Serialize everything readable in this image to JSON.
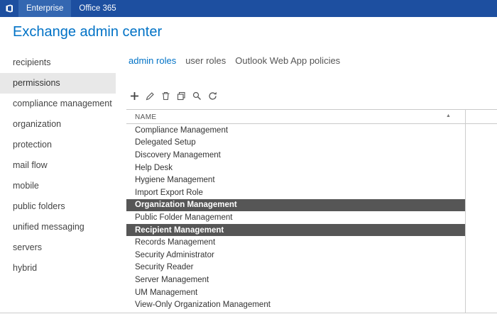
{
  "topbar": {
    "enterprise_label": "Enterprise",
    "office365_label": "Office 365"
  },
  "header": {
    "title": "Exchange admin center"
  },
  "sidebar": {
    "items": [
      {
        "label": "recipients",
        "selected": false
      },
      {
        "label": "permissions",
        "selected": true
      },
      {
        "label": "compliance management",
        "selected": false
      },
      {
        "label": "organization",
        "selected": false
      },
      {
        "label": "protection",
        "selected": false
      },
      {
        "label": "mail flow",
        "selected": false
      },
      {
        "label": "mobile",
        "selected": false
      },
      {
        "label": "public folders",
        "selected": false
      },
      {
        "label": "unified messaging",
        "selected": false
      },
      {
        "label": "servers",
        "selected": false
      },
      {
        "label": "hybrid",
        "selected": false
      }
    ]
  },
  "tabs": [
    {
      "label": "admin roles",
      "selected": true
    },
    {
      "label": "user roles",
      "selected": false
    },
    {
      "label": "Outlook Web App policies",
      "selected": false
    }
  ],
  "toolbar": {
    "icons": [
      "add-icon",
      "edit-icon",
      "delete-icon",
      "copy-icon",
      "search-icon",
      "refresh-icon"
    ]
  },
  "table": {
    "header": {
      "name": "NAME",
      "sort_indicator": "▲"
    },
    "rows": [
      {
        "label": "Compliance Management",
        "selected": false
      },
      {
        "label": "Delegated Setup",
        "selected": false
      },
      {
        "label": "Discovery Management",
        "selected": false
      },
      {
        "label": "Help Desk",
        "selected": false
      },
      {
        "label": "Hygiene Management",
        "selected": false
      },
      {
        "label": "Import Export Role",
        "selected": false
      },
      {
        "label": "Organization Management",
        "selected": true
      },
      {
        "label": "Public Folder Management",
        "selected": false
      },
      {
        "label": "Recipient Management",
        "selected": true
      },
      {
        "label": "Records Management",
        "selected": false
      },
      {
        "label": "Security Administrator",
        "selected": false
      },
      {
        "label": "Security Reader",
        "selected": false
      },
      {
        "label": "Server Management",
        "selected": false
      },
      {
        "label": "UM Management",
        "selected": false
      },
      {
        "label": "View-Only Organization Management",
        "selected": false
      }
    ]
  },
  "colors": {
    "topbar_bg": "#1d4fa0",
    "topbar_active_tab_bg": "#3467b1",
    "accent_blue": "#0072c6",
    "sidebar_selected_bg": "#e8e8e8",
    "row_selected_bg": "#565656",
    "border_gray": "#c9c9c9"
  }
}
